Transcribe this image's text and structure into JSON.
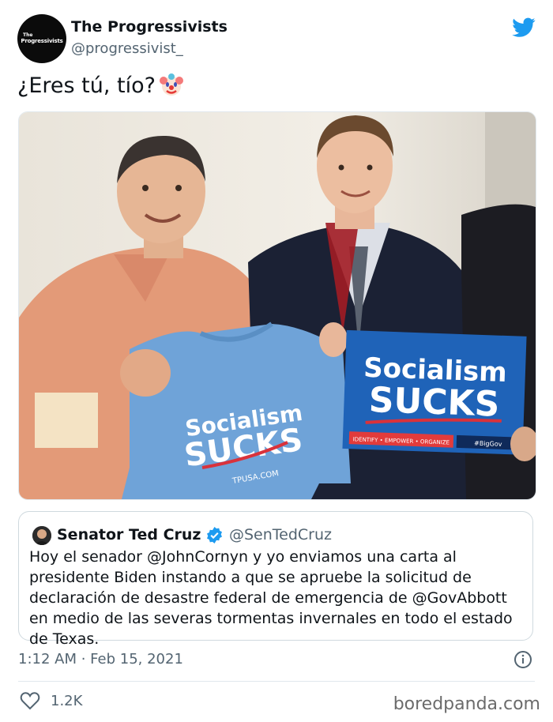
{
  "tweet": {
    "author_name": "The Progressivists",
    "author_handle": "@progressivist_",
    "avatar_text_small": "The",
    "avatar_text_brand": "Progressivists",
    "text": "¿Eres tú, tío?",
    "emoji": "clown-face",
    "timestamp": "1:12 AM · Feb 15, 2021",
    "likes": "1.2K"
  },
  "quoted_tweet": {
    "author_name": "Senator Ted Cruz",
    "author_handle": "@SenTedCruz",
    "verified": true,
    "text": "Hoy el senador @JohnCornyn y yo enviamos una carta al presidente Biden instando a que se apruebe la solicitud de declaración de desastre federal de emergencia de @GovAbbott en medio de las severas tormentas invernales en todo el estado de Texas."
  },
  "photo": {
    "shirt_line1": "Socialism",
    "shirt_line2": "SUCKS",
    "shirt_url": "TPUSA.COM",
    "sign_line1": "Socialism",
    "sign_line2": "SUCKS",
    "sign_footer": "IDENTIFY • EMPOWER • ORGANIZE",
    "sign_badge": "#BigGov"
  },
  "watermark": "boredpanda.com",
  "colors": {
    "twitter_blue": "#1d9bf0",
    "text_primary": "#0f1419",
    "text_secondary": "#536471",
    "shirt_blue": "#6fa3d8",
    "sign_blue": "#1f63b8"
  }
}
